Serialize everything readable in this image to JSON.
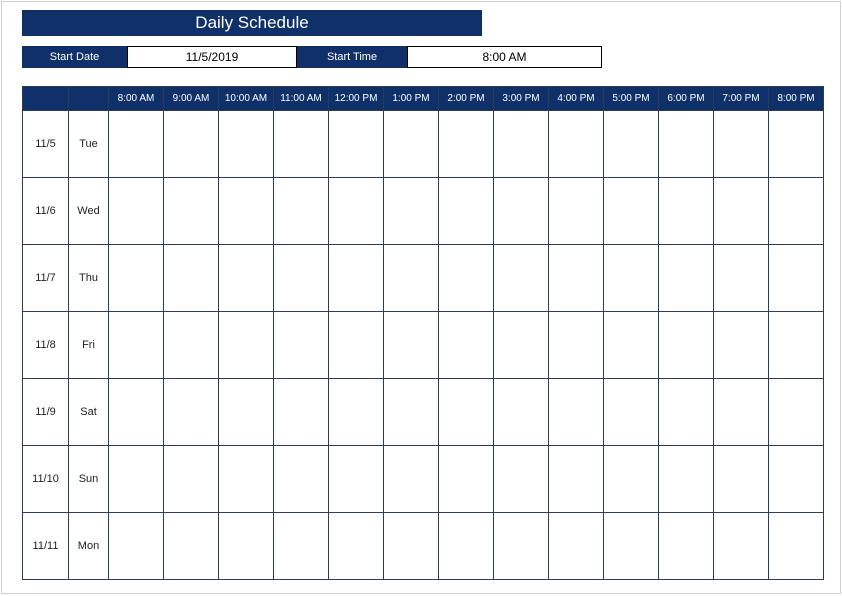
{
  "title": "Daily Schedule",
  "inputs": {
    "start_date_label": "Start Date",
    "start_date_value": "11/5/2019",
    "start_time_label": "Start Time",
    "start_time_value": "8:00 AM"
  },
  "time_headers": [
    "8:00 AM",
    "9:00 AM",
    "10:00 AM",
    "11:00 AM",
    "12:00 PM",
    "1:00 PM",
    "2:00 PM",
    "3:00 PM",
    "4:00 PM",
    "5:00 PM",
    "6:00 PM",
    "7:00 PM",
    "8:00 PM"
  ],
  "rows": [
    {
      "date": "11/5",
      "day": "Tue"
    },
    {
      "date": "11/6",
      "day": "Wed"
    },
    {
      "date": "11/7",
      "day": "Thu"
    },
    {
      "date": "11/8",
      "day": "Fri"
    },
    {
      "date": "11/9",
      "day": "Sat"
    },
    {
      "date": "11/10",
      "day": "Sun"
    },
    {
      "date": "11/11",
      "day": "Mon"
    }
  ]
}
